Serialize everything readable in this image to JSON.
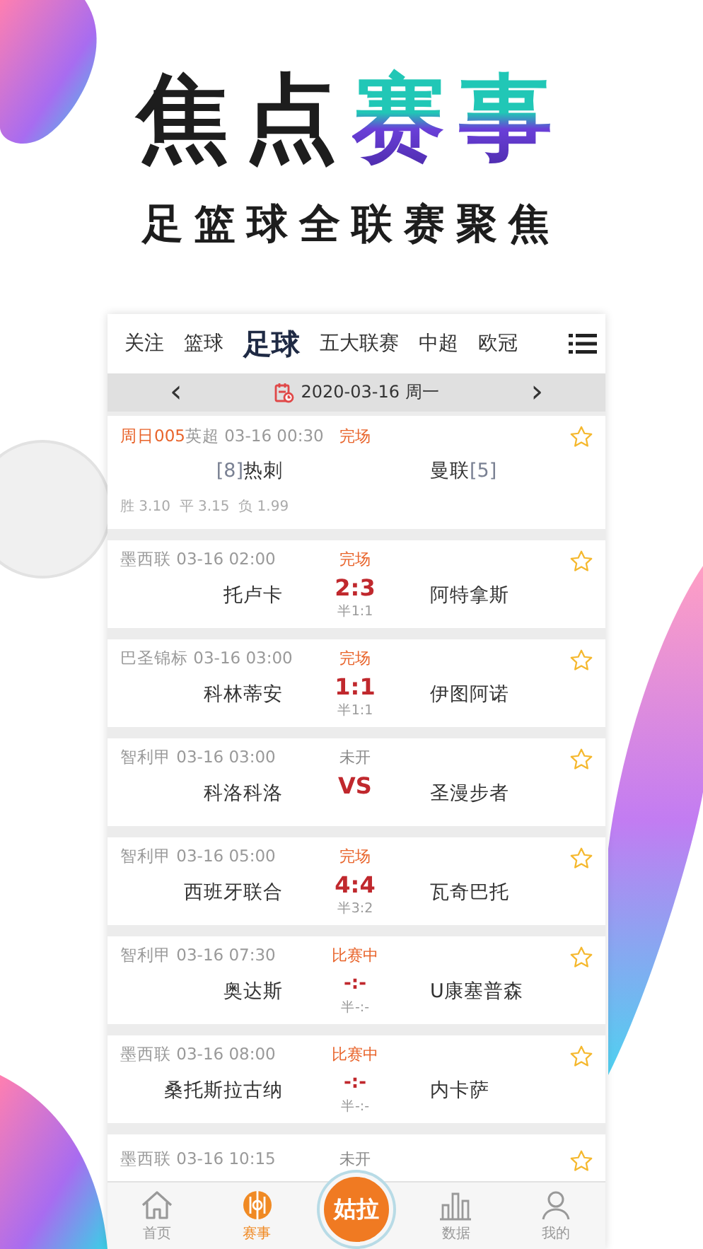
{
  "headline": {
    "dark": "焦点",
    "accent": "赛事"
  },
  "subtitle": "足篮球全联赛聚焦",
  "tabs": [
    {
      "label": "关注",
      "selected": false
    },
    {
      "label": "篮球",
      "selected": false
    },
    {
      "label": "足球",
      "selected": true
    },
    {
      "label": "五大联赛",
      "selected": false
    },
    {
      "label": "中超",
      "selected": false
    },
    {
      "label": "欧冠",
      "selected": false
    }
  ],
  "date_bar": {
    "prev": "‹",
    "date": "2020-03-16 周一",
    "next": "›"
  },
  "matches": [
    {
      "kind": "finished",
      "lottery_code": "周日005",
      "meta": "英超 03-16 00:30",
      "status": "完场",
      "home_rank": "[8]",
      "home": "热刺",
      "away": "曼联",
      "away_rank": "[5]",
      "odds": [
        {
          "label": "胜",
          "value": "3.10"
        },
        {
          "label": "平",
          "value": "3.15"
        },
        {
          "label": "负",
          "value": "1.99"
        }
      ],
      "favorite": false
    },
    {
      "kind": "finished",
      "meta": "墨西联 03-16 02:00",
      "status": "完场",
      "home": "托卢卡",
      "score": "2:3",
      "half": "半1:1",
      "away": "阿特拿斯",
      "favorite": false
    },
    {
      "kind": "finished",
      "meta": "巴圣锦标 03-16 03:00",
      "status": "完场",
      "home": "科林蒂安",
      "score": "1:1",
      "half": "半1:1",
      "away": "伊图阿诺",
      "favorite": false
    },
    {
      "kind": "not_started",
      "meta": "智利甲 03-16 03:00",
      "status": "未开",
      "home": "科洛科洛",
      "score": "VS",
      "away": "圣漫步者",
      "favorite": false
    },
    {
      "kind": "finished",
      "meta": "智利甲 03-16 05:00",
      "status": "完场",
      "home": "西班牙联合",
      "score": "4:4",
      "half": "半3:2",
      "away": "瓦奇巴托",
      "favorite": false
    },
    {
      "kind": "live",
      "meta": "智利甲 03-16 07:30",
      "status": "比赛中",
      "home": "奥达斯",
      "score": "-:-",
      "half": "半-:-",
      "away": "U康塞普森",
      "favorite": false
    },
    {
      "kind": "live",
      "meta": "墨西联 03-16 08:00",
      "status": "比赛中",
      "home": "桑托斯拉古纳",
      "score": "-:-",
      "half": "半-:-",
      "away": "内卡萨",
      "favorite": false
    },
    {
      "kind": "not_started",
      "meta": "墨西联 03-16 10:15",
      "status": "未开",
      "favorite": false
    }
  ],
  "nav": [
    {
      "kind": "home",
      "label": "首页",
      "selected": false
    },
    {
      "kind": "matches",
      "label": "赛事",
      "selected": true
    },
    {
      "kind": "logo",
      "label": "姑拉",
      "selected": false
    },
    {
      "kind": "data",
      "label": "数据",
      "selected": false
    },
    {
      "kind": "me",
      "label": "我的",
      "selected": false
    }
  ]
}
